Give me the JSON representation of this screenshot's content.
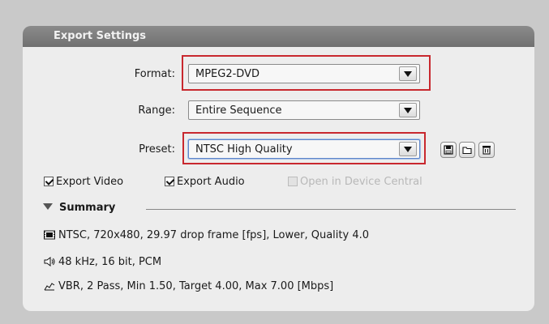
{
  "panel": {
    "title": "Export Settings"
  },
  "format": {
    "label": "Format:",
    "value": "MPEG2-DVD"
  },
  "range": {
    "label": "Range:",
    "value": "Entire Sequence"
  },
  "preset": {
    "label": "Preset:",
    "value": "NTSC High Quality",
    "buttons": [
      "save-preset-icon",
      "import-preset-icon",
      "delete-preset-icon"
    ]
  },
  "options": {
    "export_video": {
      "label": "Export Video",
      "checked": true
    },
    "export_audio": {
      "label": "Export Audio",
      "checked": true
    },
    "open_device_central": {
      "label": "Open in Device Central",
      "checked": false,
      "enabled": false
    }
  },
  "summary": {
    "title": "Summary",
    "video": "NTSC, 720x480, 29.97 drop frame [fps], Lower, Quality 4.0",
    "audio": "48 kHz, 16 bit, PCM",
    "bitrate": "VBR, 2 Pass, Min 1.50, Target 4.00, Max 7.00 [Mbps]"
  },
  "colors": {
    "highlight": "#c8282e",
    "panel_bg": "#ededed",
    "header_bg": "#7a7a7a",
    "page_bg": "#c9c9c9"
  }
}
